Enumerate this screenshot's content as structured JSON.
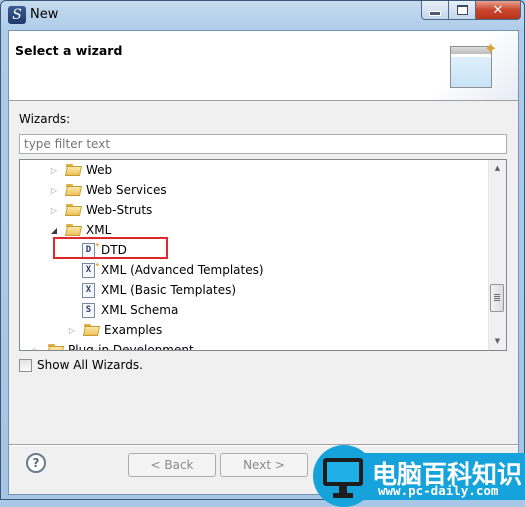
{
  "window": {
    "title": "New",
    "app_icon": "eclipse-s-icon",
    "controls": {
      "minimize": "minimize",
      "maximize": "maximize",
      "close": "✕"
    }
  },
  "header": {
    "title": "Select a wizard",
    "banner_icon": "new-wizard-icon"
  },
  "wizards_label": "Wizards:",
  "filter": {
    "placeholder": "type filter text",
    "value": ""
  },
  "tree": {
    "items": [
      {
        "label": "Web",
        "type": "folder",
        "expanded": false,
        "level": 1
      },
      {
        "label": "Web Services",
        "type": "folder",
        "expanded": false,
        "level": 1
      },
      {
        "label": "Web-Struts",
        "type": "folder",
        "expanded": false,
        "level": 1
      },
      {
        "label": "XML",
        "type": "folder",
        "expanded": true,
        "level": 1
      },
      {
        "label": "DTD",
        "type": "file",
        "icon_letter": "D",
        "level": 2,
        "highlighted": true
      },
      {
        "label": "XML (Advanced Templates)",
        "type": "file",
        "icon_letter": "X",
        "level": 2
      },
      {
        "label": "XML (Basic Templates)",
        "type": "file",
        "icon_letter": "X",
        "level": 2
      },
      {
        "label": "XML Schema",
        "type": "file",
        "icon_letter": "S",
        "level": 2
      },
      {
        "label": "Examples",
        "type": "folder",
        "expanded": false,
        "level": 2
      },
      {
        "label": "Plug-in Development",
        "type": "folder",
        "expanded": false,
        "level": 0,
        "clipped": true
      }
    ],
    "scroll_position_fraction": 0.85
  },
  "show_all": {
    "label": "Show All Wizards.",
    "checked": false
  },
  "buttons": {
    "back": "< Back",
    "next": "Next >",
    "help": "?"
  },
  "watermark": {
    "chinese": "电脑百科知识",
    "url": "www.pc-daily.com"
  },
  "colors": {
    "highlight_box": "#e2262b",
    "watermark_blue": "#16a3dc"
  }
}
